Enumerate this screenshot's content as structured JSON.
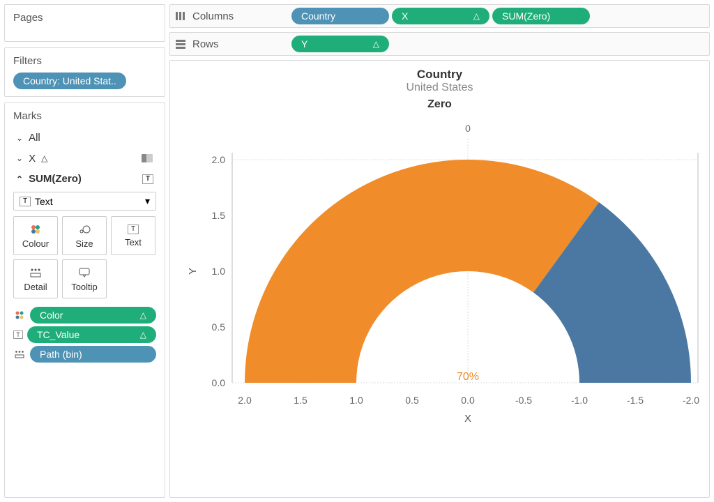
{
  "shelves": {
    "columns_label": "Columns",
    "rows_label": "Rows",
    "columns_pills": [
      "Country",
      "X",
      "SUM(Zero)"
    ],
    "rows_pills": [
      "Y"
    ]
  },
  "pages": {
    "title": "Pages"
  },
  "filters": {
    "title": "Filters",
    "pill": "Country: United Stat.."
  },
  "marks": {
    "title": "Marks",
    "all": "All",
    "x_row": "X",
    "sumzero": "SUM(Zero)",
    "dropdown": "Text",
    "btns": {
      "colour": "Colour",
      "size": "Size",
      "text": "Text",
      "detail": "Detail",
      "tooltip": "Tooltip"
    },
    "pills": {
      "color": "Color",
      "tcvalue": "TC_Value",
      "pathbin": "Path (bin)"
    }
  },
  "chart_data": {
    "type": "pie",
    "title": "Country",
    "subtitle": "United States",
    "zero_title": "Zero",
    "zero_value": "0",
    "center_label": "70%",
    "gauge_percent": 70,
    "colors": {
      "active": "#f08c29",
      "rest": "#4a78a2"
    },
    "inner_radius_ratio": 0.5,
    "x_ticks": [
      "2.0",
      "1.5",
      "1.0",
      "0.5",
      "0.0",
      "-0.5",
      "-1.0",
      "-1.5",
      "-2.0"
    ],
    "y_ticks": [
      "0.0",
      "0.5",
      "1.0",
      "1.5",
      "2.0"
    ],
    "xlabel": "X",
    "ylabel": "Y",
    "xlim": [
      2.0,
      -2.0
    ],
    "ylim": [
      0.0,
      2.0
    ]
  }
}
